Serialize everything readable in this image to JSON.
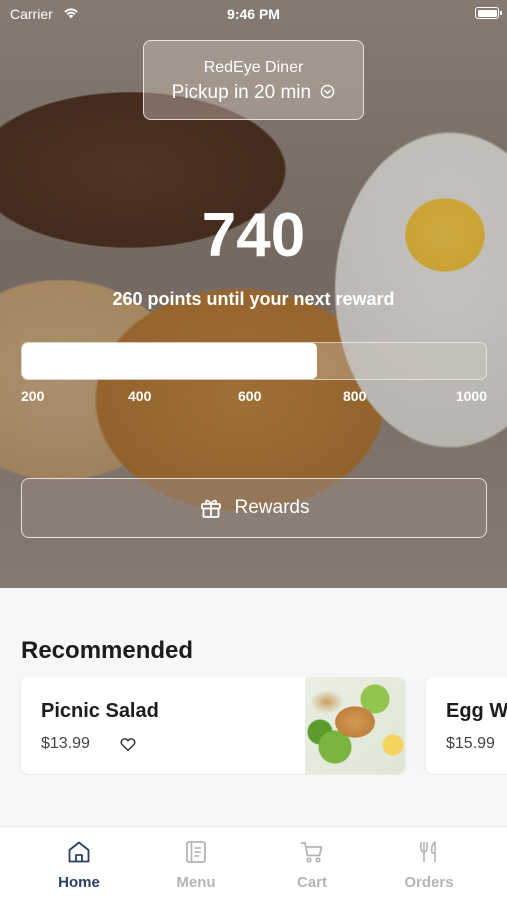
{
  "status_bar": {
    "carrier": "Carrier",
    "time": "9:46 PM"
  },
  "store": {
    "name": "RedEye Diner",
    "pickup": "Pickup in 20 min"
  },
  "points": {
    "value": "740",
    "caption": "260 points until your next reward",
    "progress_fraction": 0.635,
    "ticks": [
      "200",
      "400",
      "600",
      "800",
      "1000"
    ]
  },
  "rewards_button": {
    "label": "Rewards"
  },
  "recommended": {
    "title": "Recommended",
    "items": [
      {
        "name": "Picnic Salad",
        "price": "$13.99"
      },
      {
        "name": "Egg W",
        "price": "$15.99"
      }
    ]
  },
  "tabs": [
    {
      "label": "Home",
      "icon": "home-icon",
      "active": true
    },
    {
      "label": "Menu",
      "icon": "menu-icon",
      "active": false
    },
    {
      "label": "Cart",
      "icon": "cart-icon",
      "active": false
    },
    {
      "label": "Orders",
      "icon": "orders-icon",
      "active": false
    }
  ],
  "colors": {
    "active_tab": "#2a3f66",
    "inactive_tab": "#b4b4b4",
    "background": "#f7f7f7"
  }
}
